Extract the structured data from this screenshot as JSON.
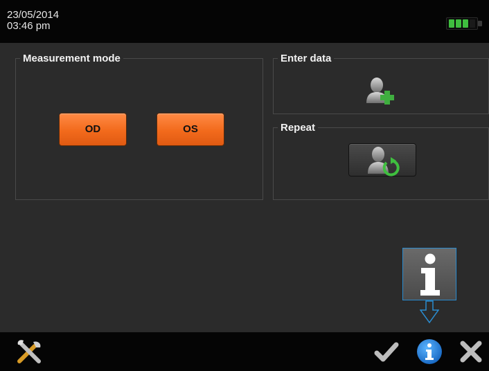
{
  "status_bar": {
    "date": "23/05/2014",
    "time": "03:46 pm",
    "battery": {
      "level": 0.75,
      "color": "#3fbf3f"
    }
  },
  "measurement_mode": {
    "title": "Measurement mode",
    "od_label": "OD",
    "os_label": "OS",
    "button_color": "#f26a1c"
  },
  "enter_data": {
    "title": "Enter data",
    "icon": "add-patient-icon"
  },
  "repeat": {
    "title": "Repeat",
    "icon": "repeat-patient-icon"
  },
  "info_overlay": {
    "icon": "info-large-icon",
    "accent_color": "#2a8cd0"
  },
  "bottom_bar": {
    "icons": [
      "tools-icon",
      "check-icon",
      "info-icon",
      "close-icon"
    ]
  }
}
